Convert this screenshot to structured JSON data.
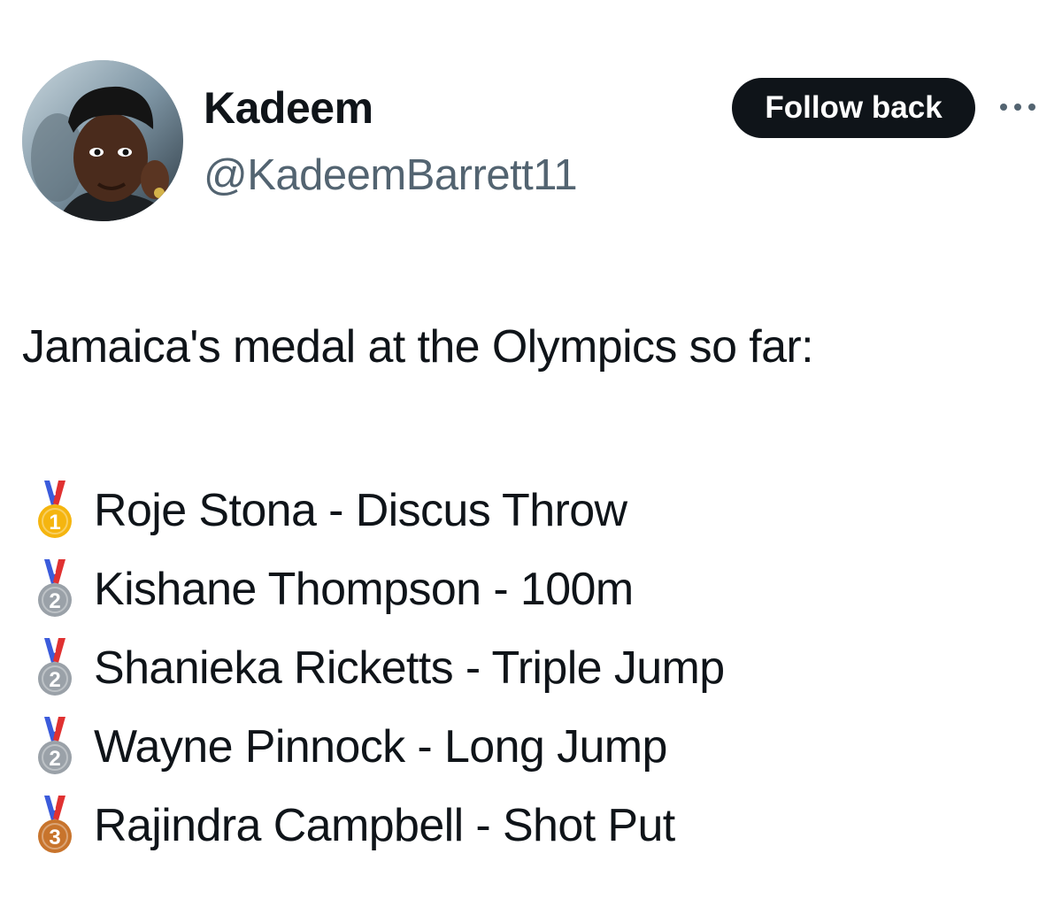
{
  "profile": {
    "display_name": "Kadeem",
    "handle": "@KadeemBarrett11",
    "follow_label": "Follow back"
  },
  "tweet": {
    "intro": "Jamaica's medal at the Olympics so far:",
    "medals": [
      {
        "rank": "1",
        "medal": "gold",
        "color": "#f5b50f",
        "text": "Roje Stona - Discus Throw"
      },
      {
        "rank": "2",
        "medal": "silver",
        "color": "#9aa1a8",
        "text": "Kishane Thompson - 100m"
      },
      {
        "rank": "2",
        "medal": "silver",
        "color": "#9aa1a8",
        "text": "Shanieka Ricketts - Triple Jump"
      },
      {
        "rank": "2",
        "medal": "silver",
        "color": "#9aa1a8",
        "text": "Wayne Pinnock - Long Jump"
      },
      {
        "rank": "3",
        "medal": "bronze",
        "color": "#c8742c",
        "text": "Rajindra Campbell - Shot Put"
      }
    ]
  },
  "icons": {
    "avatar": "profile-photo",
    "more": "more-dots-icon",
    "medal": "sports-medal-icon"
  }
}
